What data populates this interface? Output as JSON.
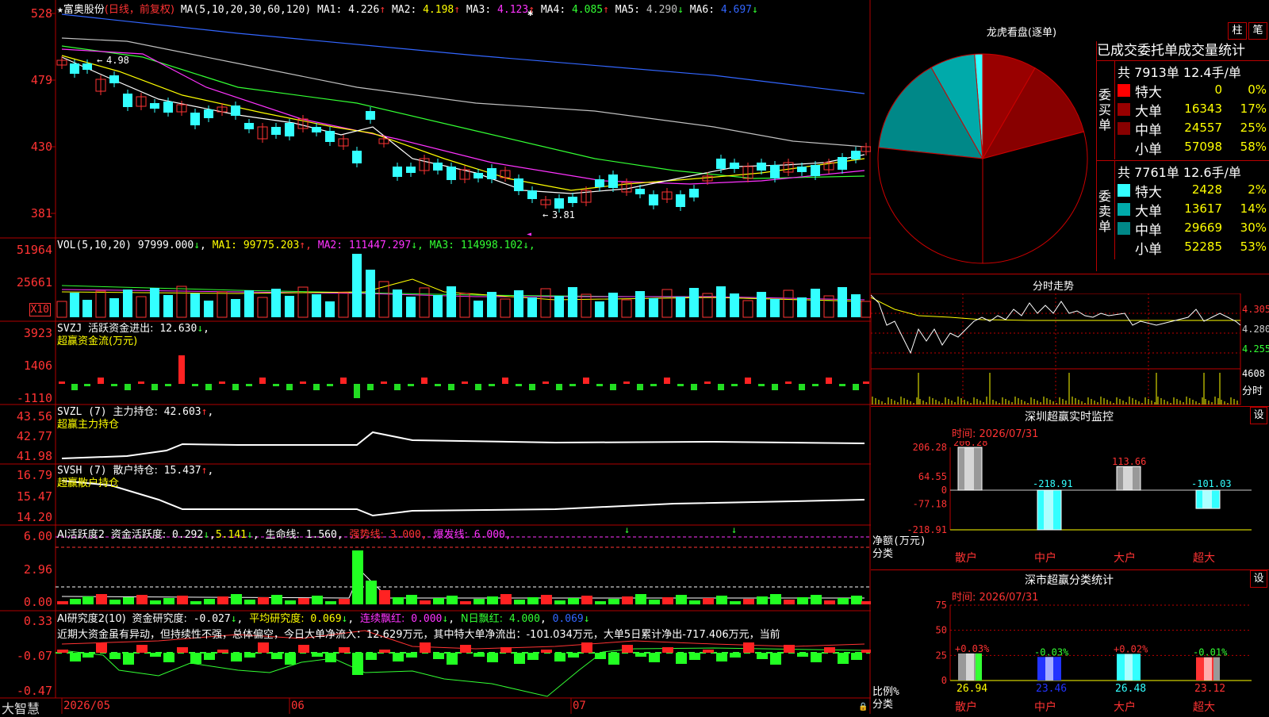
{
  "stock": {
    "name": "富奥股份",
    "mode": "(日线，前复权)"
  },
  "ma_line": {
    "label": "MA(5,10,20,30,60,120)",
    "items": [
      {
        "name": "MA1:",
        "value": "4.226",
        "arrow": "↑",
        "color": "#ffffff"
      },
      {
        "name": "MA2:",
        "value": "4.198",
        "arrow": "↑",
        "color": "#ffff00"
      },
      {
        "name": "MA3:",
        "value": "4.123",
        "arrow": "↑",
        "color": "#ff33ff"
      },
      {
        "name": "MA4:",
        "value": "4.085",
        "arrow": "↑",
        "color": "#33ff33"
      },
      {
        "name": "MA5:",
        "value": "4.290",
        "arrow": "↓",
        "color": "#c0c0c0"
      },
      {
        "name": "MA6:",
        "value": "4.697",
        "arrow": "↓",
        "color": "#3366ff"
      }
    ]
  },
  "price_axis": [
    "528",
    "479",
    "430",
    "381"
  ],
  "price_marks": {
    "high": "4.98",
    "low": "3.81"
  },
  "vol": {
    "label": "VOL(5,10,20)",
    "value": "97999.000",
    "arrow": "↓",
    "items": [
      {
        "name": "MA1:",
        "value": "99775.203",
        "arrow": "↑",
        "color": "#ffff00"
      },
      {
        "name": "MA2:",
        "value": "111447.297",
        "arrow": "↓",
        "color": "#ff33ff"
      },
      {
        "name": "MA3:",
        "value": "114998.102",
        "arrow": "↓",
        "color": "#33ff33"
      }
    ],
    "axis": [
      "51964",
      "25661"
    ],
    "unit": "X10"
  },
  "svzj": {
    "label": "SVZJ",
    "title": "活跃资金进出:",
    "value": "12.630",
    "arrow": "↓",
    "subtitle": "超赢资金流(万元)",
    "axis": [
      "3923",
      "1406",
      "-1110"
    ]
  },
  "svzl": {
    "label": "SVZL (7)",
    "title": "主力持仓:",
    "value": "42.603",
    "arrow": "↑",
    "subtitle": "超赢主力持仓",
    "axis": [
      "43.56",
      "42.77",
      "41.98"
    ]
  },
  "svsh": {
    "label": "SVSH (7)",
    "title": "散户持仓:",
    "value": "15.437",
    "arrow": "↑",
    "subtitle": "超赢散户持仓",
    "axis": [
      "16.79",
      "15.47",
      "14.20"
    ]
  },
  "ai_active": {
    "label": "AI活跃度2",
    "title": "资金活跃度:",
    "v1": "0.292",
    "v2": "5.141",
    "life": "生命线:",
    "life_v": "1.560",
    "strong": "强势线:",
    "strong_v": "3.000",
    "burst": "爆发线:",
    "burst_v": "6.000",
    "axis": [
      "6.00",
      "2.96",
      "0.00"
    ]
  },
  "ai_research": {
    "label": "AI研究度2(10)",
    "title": "资金研究度:",
    "v1": "-0.027",
    "avg": "平均研究度:",
    "avg_v": "0.069",
    "red": "连续飘红:",
    "red_v": "0.000",
    "nred": "N日飘红:",
    "nred_v": "4.000",
    "v5": "0.069",
    "axis": [
      "0.33",
      "-0.07",
      "-0.47"
    ],
    "comment": "近期大资金虽有异动，但持续性不强，总体偏空，今日大单净流入：12.629万元，其中特大单净流出：-101.034万元，大单5日累计净出-717.406万元，当前"
  },
  "dates": [
    "2026/05",
    "06",
    "07"
  ],
  "brand": "大智慧",
  "right": {
    "lhb_title": "龙虎看盘(逐单)",
    "btn_zhu": "柱",
    "btn_bi": "笔",
    "stat_title": "已成交委托单成交量统计",
    "buy": {
      "label": "委买单",
      "summary": "共 7913单 12.4手/单",
      "rows": [
        {
          "k": "特大",
          "v": "0",
          "p": "0%",
          "c": "#ff0000"
        },
        {
          "k": "大单",
          "v": "16343",
          "p": "17%",
          "c": "#990000"
        },
        {
          "k": "中单",
          "v": "24557",
          "p": "25%",
          "c": "#880000"
        },
        {
          "k": "小单",
          "v": "57098",
          "p": "58%",
          "c": "#000000"
        }
      ]
    },
    "sell": {
      "label": "委卖单",
      "summary": "共 7761单 12.6手/单",
      "rows": [
        {
          "k": "特大",
          "v": "2428",
          "p": "2%",
          "c": "#33ffff"
        },
        {
          "k": "大单",
          "v": "13617",
          "p": "14%",
          "c": "#00aaaa"
        },
        {
          "k": "中单",
          "v": "29669",
          "p": "30%",
          "c": "#008888"
        },
        {
          "k": "小单",
          "v": "52285",
          "p": "53%",
          "c": "#000000"
        }
      ]
    },
    "fs_title": "分时走势",
    "fs_axis": [
      "4.305",
      "4.280",
      "4.255"
    ],
    "fs_vol": "4608",
    "fs_unit": "分时",
    "mon_title": "深圳超赢实时监控",
    "mon_settings": "设",
    "mon_time": "时间: 2026/07/31",
    "mon_axis": [
      "206.28",
      "64.55",
      "0",
      "-77.18",
      "-218.91"
    ],
    "mon_bars": [
      {
        "cat": "散户",
        "value": 206.28,
        "label": "206.28"
      },
      {
        "cat": "中户",
        "value": -218.91,
        "label": "-218.91"
      },
      {
        "cat": "大户",
        "value": 113.66,
        "label": "113.66"
      },
      {
        "cat": "超大",
        "value": -101.03,
        "label": "-101.03"
      }
    ],
    "mon_ylabel": "净额(万元)",
    "mon_xlabel": "分类",
    "cls_title": "深市超赢分类统计",
    "cls_settings": "设",
    "cls_time": "时间: 2026/07/31",
    "cls_axis": [
      "75",
      "50",
      "25",
      "0"
    ],
    "cls_bars": [
      {
        "cat": "散户",
        "value": 26.94,
        "chg": "+0.03%"
      },
      {
        "cat": "中户",
        "value": 23.46,
        "chg": "-0.03%"
      },
      {
        "cat": "大户",
        "value": 26.48,
        "chg": "+0.02%"
      },
      {
        "cat": "超大",
        "value": 23.12,
        "chg": "-0.01%"
      }
    ],
    "cls_ylabel": "比例%",
    "cls_xlabel": "分类"
  }
}
